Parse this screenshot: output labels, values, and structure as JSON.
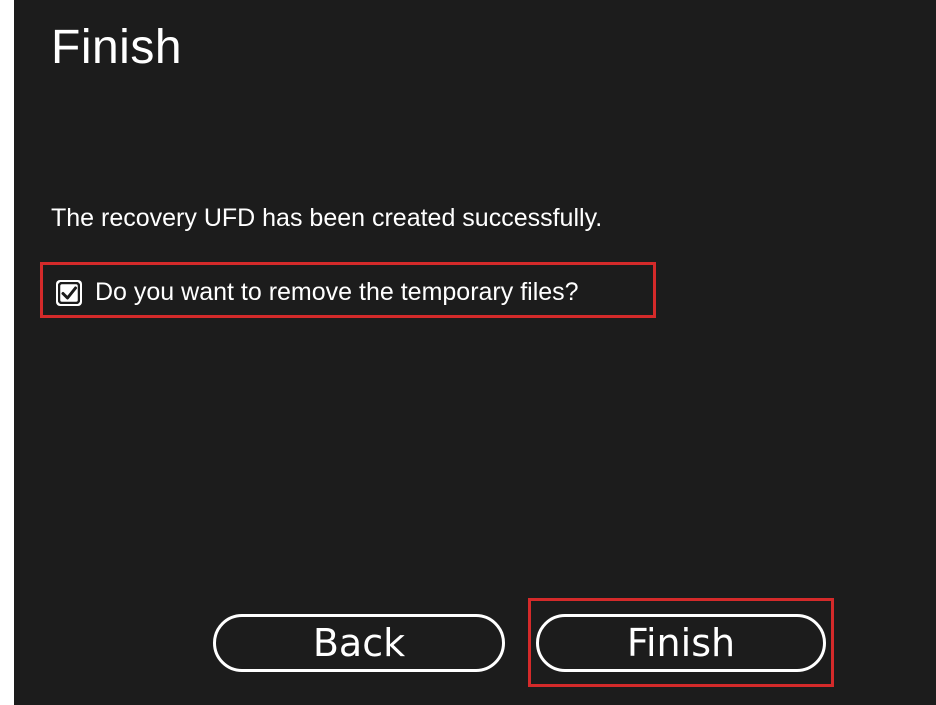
{
  "page": {
    "title": "Finish",
    "message": "The recovery UFD has been created successfully."
  },
  "options": {
    "remove_temp_files": {
      "label": "Do you want to remove the temporary files?",
      "checked": true
    }
  },
  "buttons": {
    "back_label": "Back",
    "finish_label": "Finish"
  },
  "colors": {
    "background": "#1c1c1c",
    "text": "#ffffff",
    "highlight": "#d42a2a"
  },
  "icons": {
    "checkbox": "checkmark-icon"
  }
}
